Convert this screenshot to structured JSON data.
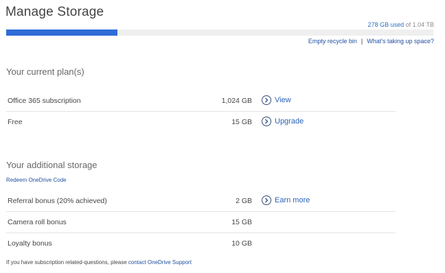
{
  "header": {
    "title": "Manage Storage",
    "usage_used": "278 GB used",
    "usage_of": " of 1.04 TB",
    "usage_fraction": 0.26,
    "bar_color": "#2f6cd6",
    "empty_recycle_bin": "Empty recycle bin",
    "separator": "|",
    "whats_taking_space": "What's taking up space?"
  },
  "current_plans": {
    "heading": "Your current plan(s)",
    "rows": [
      {
        "label": "Office 365 subscription",
        "amount": "1,024 GB",
        "action": "View",
        "action_icon": "chevron-right-circle-icon"
      },
      {
        "label": "Free",
        "amount": "15 GB",
        "action": "Upgrade",
        "action_icon": "chevron-right-circle-icon"
      }
    ]
  },
  "additional_storage": {
    "heading": "Your additional storage",
    "redeem_link": "Redeem OneDrive Code",
    "rows": [
      {
        "label": "Referral bonus (20% achieved)",
        "amount": "2 GB",
        "action": "Earn more",
        "action_icon": "chevron-right-circle-icon"
      },
      {
        "label": "Camera roll bonus",
        "amount": "15 GB"
      },
      {
        "label": "Loyalty bonus",
        "amount": "10 GB"
      }
    ]
  },
  "footer": {
    "note_text": "If you have subscription related-questions, please ",
    "support_link": "contact OneDrive Support"
  },
  "colors": {
    "accent": "#2f6cd6",
    "link": "#2050a0",
    "action_link": "#2b62b8"
  }
}
